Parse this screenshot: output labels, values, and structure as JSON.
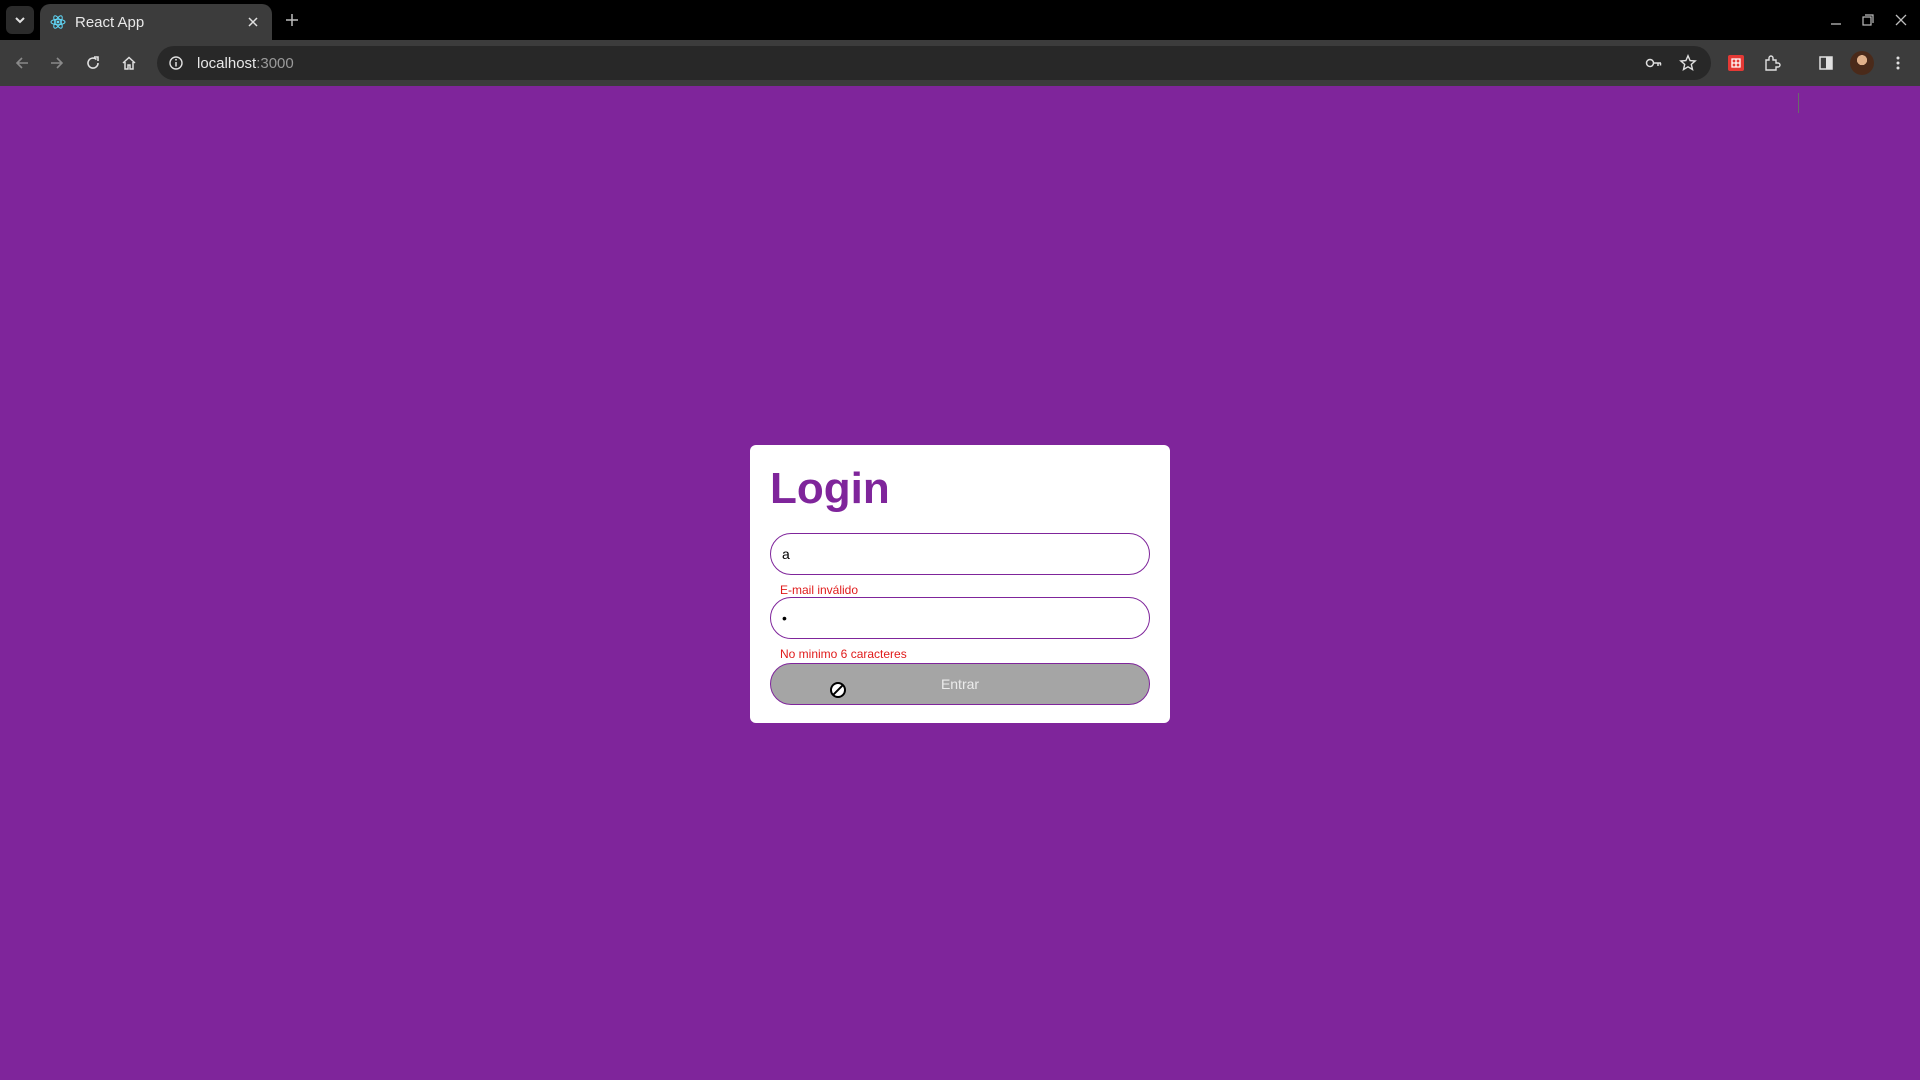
{
  "browser": {
    "tab_title": "React App",
    "url_host": "localhost",
    "url_port": ":3000",
    "icons": [
      "tab-search-icon",
      "react-favicon-icon",
      "close-icon",
      "plus-icon",
      "minimize-icon",
      "restore-icon",
      "window-close-icon",
      "back-icon",
      "forward-icon",
      "reload-icon",
      "home-icon",
      "info-icon",
      "key-icon",
      "star-icon",
      "extension-icon",
      "puzzle-icon",
      "sidepanel-icon",
      "avatar",
      "menu-icon"
    ]
  },
  "colors": {
    "page_background": "#7f259b",
    "accent": "#7f259b",
    "error": "#e01b1b",
    "button_disabled": "#a5a5a5"
  },
  "login": {
    "title": "Login",
    "email_value": "a",
    "email_error": "E-mail inválido",
    "password_value": "•",
    "password_error": "No minimo 6 caracteres",
    "submit_label": "Entrar",
    "submit_state": "disabled"
  }
}
